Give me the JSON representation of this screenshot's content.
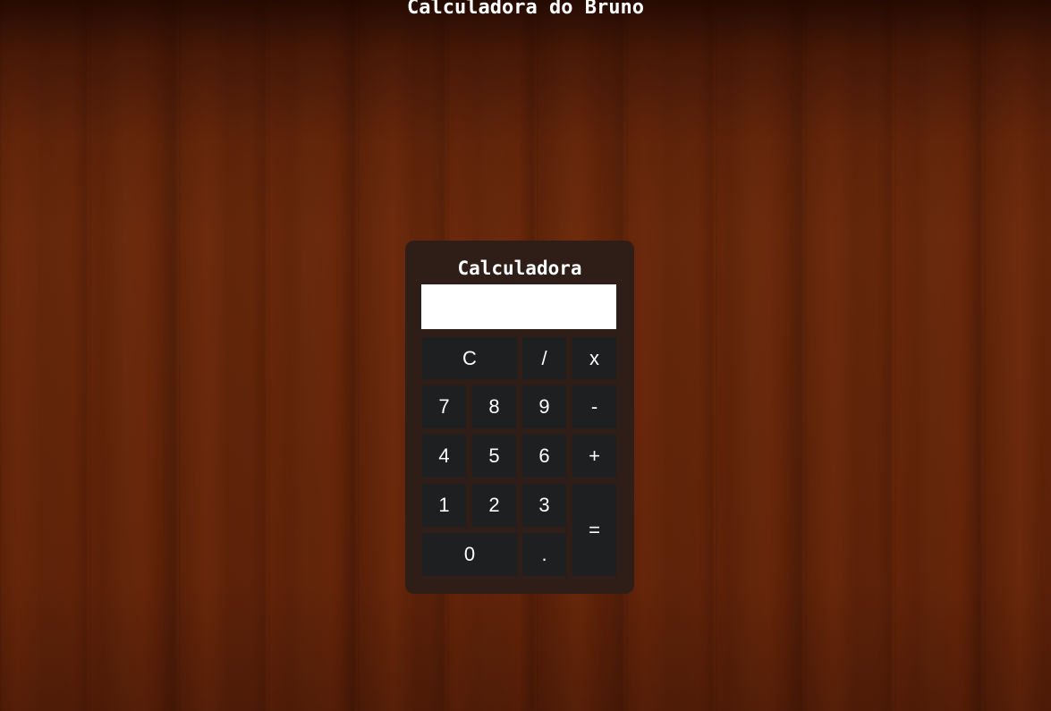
{
  "page": {
    "title": "Calculadora do Bruno"
  },
  "calculator": {
    "title": "Calculadora",
    "display_value": "",
    "keys": {
      "clear": "C",
      "divide": "/",
      "multiply": "x",
      "seven": "7",
      "eight": "8",
      "nine": "9",
      "subtract": "-",
      "four": "4",
      "five": "5",
      "six": "6",
      "add": "+",
      "one": "1",
      "two": "2",
      "three": "3",
      "equals": "=",
      "zero": "0",
      "decimal": "."
    }
  },
  "colors": {
    "panel": "#2e1e17",
    "key": "#1e1f20",
    "display": "#ffffff",
    "text": "#ffffff"
  }
}
